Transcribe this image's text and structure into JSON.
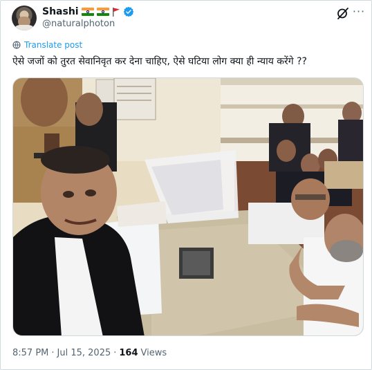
{
  "author": {
    "display_name": "Shashi",
    "handle": "@naturalphoton",
    "verified": true,
    "name_emoji": [
      "indian-flag",
      "indian-flag",
      "red-flag"
    ]
  },
  "header_actions": {
    "grok_icon": "grok-icon",
    "more_label": "···"
  },
  "translate": {
    "label": "Translate post"
  },
  "post": {
    "text": "ऐसे जजों को तुरत सेवानिवृत कर देना चाहिए, ऐसे घटिया लोग क्या ही न्याय करेंगे ??"
  },
  "media": {
    "type": "photo"
  },
  "meta": {
    "time": "8:57 PM",
    "separator": "·",
    "date": "Jul 15, 2025",
    "views_count": "164",
    "views_label": "Views"
  },
  "colors": {
    "accent": "#1d9bf0",
    "secondary_text": "#536471",
    "primary_text": "#0f1419",
    "border": "#cfd9de"
  }
}
